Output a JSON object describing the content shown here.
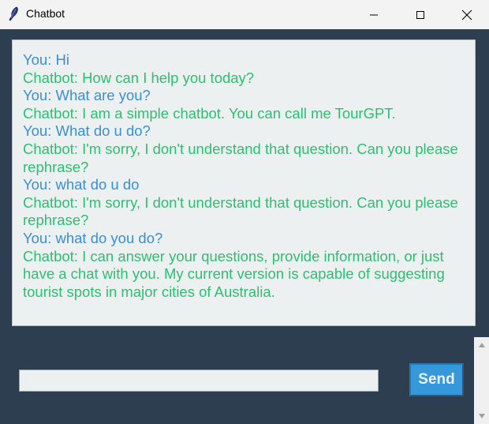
{
  "window": {
    "title": "Chatbot",
    "icon": "feather-icon"
  },
  "window_controls": {
    "minimize": "minimize-icon",
    "maximize": "maximize-icon",
    "close": "close-icon"
  },
  "chat": {
    "messages": [
      {
        "sender": "user",
        "text": "You: Hi"
      },
      {
        "sender": "bot",
        "text": "Chatbot: How can I help you today?"
      },
      {
        "sender": "user",
        "text": "You: What are you?"
      },
      {
        "sender": "bot",
        "text": "Chatbot: I am a simple chatbot. You can call me TourGPT."
      },
      {
        "sender": "user",
        "text": "You: What do u do?"
      },
      {
        "sender": "bot",
        "text": "Chatbot: I'm sorry, I don't understand that question. Can you please rephrase?"
      },
      {
        "sender": "user",
        "text": "You: what do u do"
      },
      {
        "sender": "bot",
        "text": "Chatbot: I'm sorry, I don't understand that question. Can you please rephrase?"
      },
      {
        "sender": "user",
        "text": "You: what do you do?"
      },
      {
        "sender": "bot",
        "text": "Chatbot: I can answer your questions, provide information, or just have a chat with you. My current version is capable of suggesting tourist spots in major cities of Australia."
      }
    ]
  },
  "input": {
    "value": "",
    "placeholder": ""
  },
  "send_button": {
    "label": "Send"
  },
  "colors": {
    "background": "#2c3e50",
    "chat_bg": "#ecf0f1",
    "user_text": "#3b8fd0",
    "bot_text": "#2ebe72",
    "send_button": "#3498db"
  }
}
